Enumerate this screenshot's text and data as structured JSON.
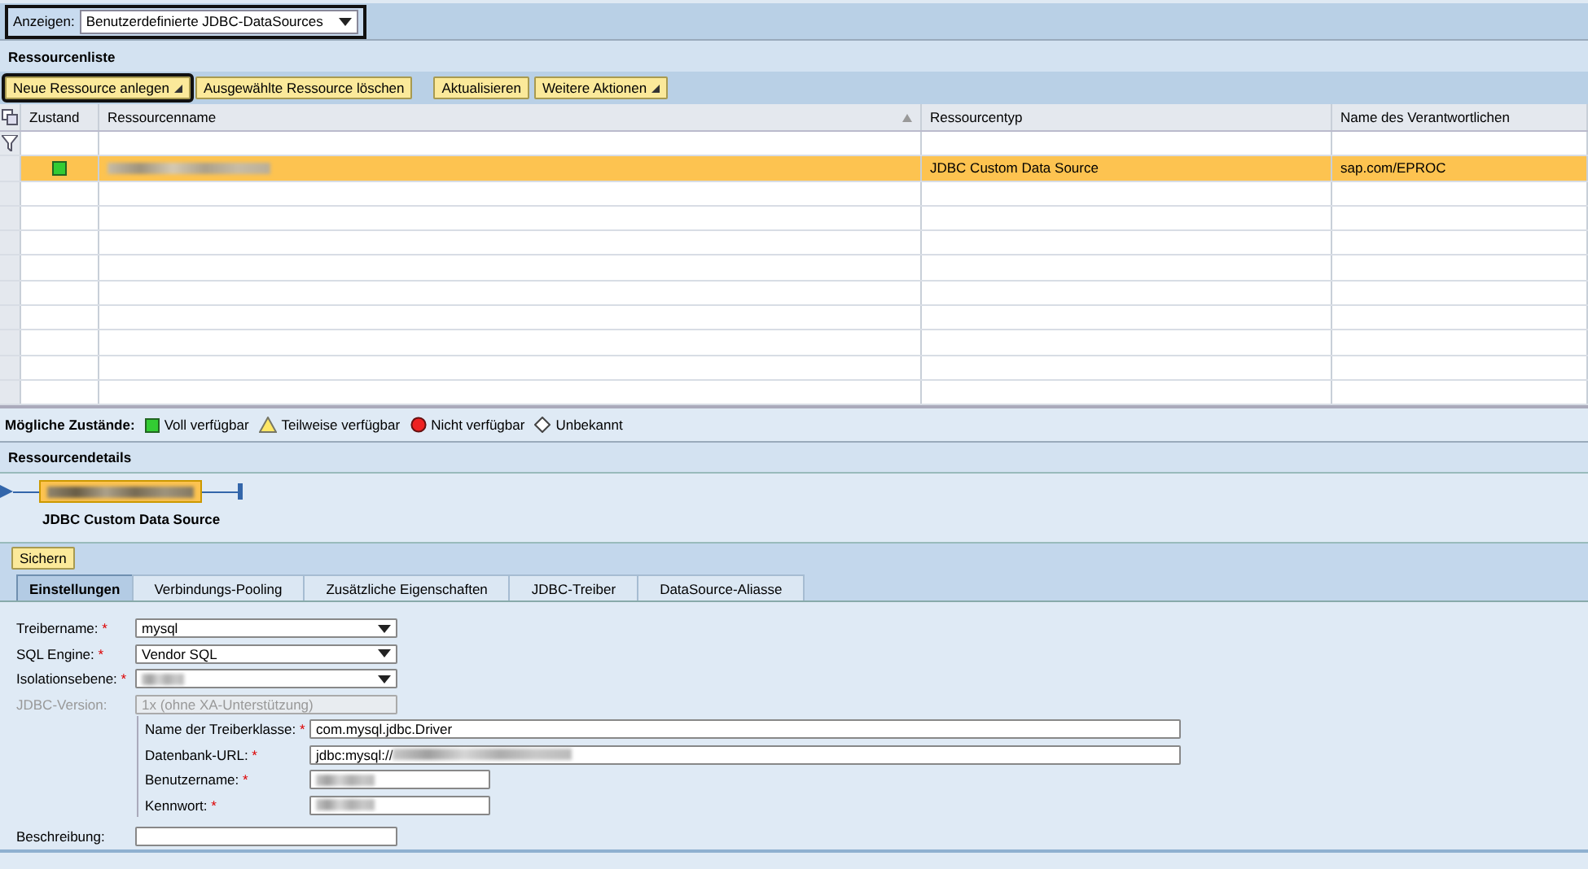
{
  "view_selector": {
    "label": "Anzeigen:",
    "value": "Benutzerdefinierte JDBC-DataSources"
  },
  "resource_list": {
    "title": "Ressourcenliste",
    "toolbar": [
      {
        "label": "Neue Ressource anlegen",
        "menu": true,
        "focused": true
      },
      {
        "label": "Ausgewählte Ressource löschen",
        "menu": false,
        "focused": false
      },
      {
        "label": "Aktualisieren",
        "menu": false,
        "focused": false
      },
      {
        "label": "Weitere Aktionen",
        "menu": true,
        "focused": false
      }
    ],
    "columns": [
      "Zustand",
      "Ressourcenname",
      "Ressourcentyp",
      "Name des Verantwortlichen"
    ],
    "rows": [
      {
        "color": "#33cc33",
        "name_blurred": true,
        "type": "JDBC Custom Data Source",
        "owner": "sap.com/EPROC",
        "selected": true
      }
    ]
  },
  "legend": {
    "label": "Mögliche Zustände:",
    "items": [
      {
        "kind": "available",
        "label": "Voll verfügbar"
      },
      {
        "kind": "partial",
        "label": "Teilweise verfügbar"
      },
      {
        "kind": "unavailable",
        "label": "Nicht verfügbar"
      },
      {
        "kind": "unknown",
        "label": "Unbekannt"
      }
    ]
  },
  "details": {
    "title": "Ressourcendetails",
    "node_caption": "JDBC Custom Data Source",
    "save_button": "Sichern",
    "tabs": [
      {
        "label": "Einstellungen",
        "selected": true
      },
      {
        "label": "Verbindungs-Pooling",
        "selected": false
      },
      {
        "label": "Zusätzliche Eigenschaften",
        "selected": false
      },
      {
        "label": "JDBC-Treiber",
        "selected": false
      },
      {
        "label": "DataSource-Aliasse",
        "selected": false
      }
    ],
    "fields": [
      {
        "label": "Treibername:",
        "kind": "select",
        "required_mark": "*",
        "value": "mysql",
        "blurred": false,
        "disabled": false
      },
      {
        "label": "SQL Engine:",
        "kind": "select",
        "required_mark": "*",
        "value": "Vendor SQL",
        "blurred": false,
        "disabled": false
      },
      {
        "label": "Isolationsebene:",
        "kind": "select",
        "required_mark": "*",
        "blurred": true,
        "disabled": false
      },
      {
        "label": "JDBC-Version:",
        "kind": "input",
        "value": "1x (ohne XA-Unterstützung)",
        "blurred": false,
        "disabled": true
      }
    ],
    "driver_fields": [
      {
        "label": "Name der Treiberklasse:",
        "required_mark": "*",
        "value": "com.mysql.jdbc.Driver",
        "blurred": false,
        "wide": true
      },
      {
        "label": "Datenbank-URL:",
        "required_mark": "*",
        "value": "jdbc:mysql://",
        "blurred": true,
        "wide": true
      },
      {
        "label": "Benutzername:",
        "required_mark": "*",
        "blurred": true,
        "wide": false
      },
      {
        "label": "Kennwort:",
        "required_mark": "*",
        "blurred": true,
        "wide": false
      }
    ],
    "description": {
      "label": "Beschreibung:"
    }
  }
}
